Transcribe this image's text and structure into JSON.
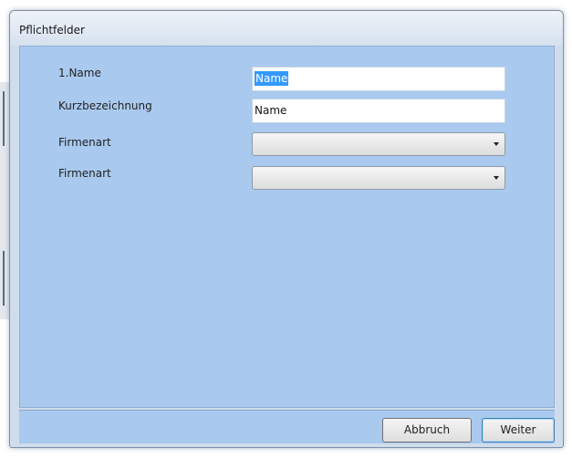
{
  "dialog": {
    "title": "Pflichtfelder"
  },
  "form": {
    "fields": [
      {
        "label": "1.Name",
        "type": "text",
        "value": "Name",
        "selected": true
      },
      {
        "label": "Kurzbezeichnung",
        "type": "text",
        "value": "Name",
        "selected": false
      },
      {
        "label": "Firmenart",
        "type": "combo",
        "value": ""
      },
      {
        "label": "Firmenart",
        "type": "combo",
        "value": ""
      }
    ]
  },
  "buttons": {
    "cancel_label": "Abbruch",
    "next_label": "Weiter"
  },
  "colors": {
    "client_background": "#a9c9ee",
    "selection_highlight": "#3399ff"
  }
}
